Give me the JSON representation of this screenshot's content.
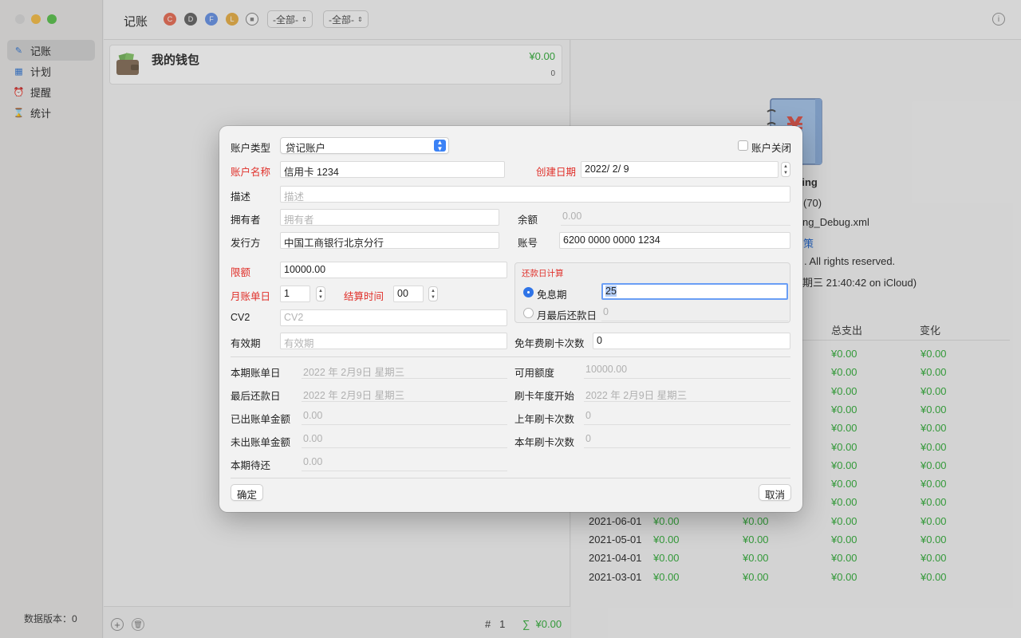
{
  "sidebar": {
    "items": [
      {
        "label": "记账",
        "icon": "edit-icon"
      },
      {
        "label": "计划",
        "icon": "calendar-icon"
      },
      {
        "label": "提醒",
        "icon": "alarm-icon"
      },
      {
        "label": "统计",
        "icon": "hourglass-icon"
      }
    ],
    "version": "数据版本：0"
  },
  "toolbar": {
    "title": "记账",
    "chips": [
      {
        "letter": "C",
        "color": "#e8735c"
      },
      {
        "letter": "D",
        "color": "#6b6b6b"
      },
      {
        "letter": "F",
        "color": "#6e97e6"
      },
      {
        "letter": "L",
        "color": "#e8b24f"
      }
    ],
    "filter1": "-全部-",
    "filter2": "-全部-"
  },
  "accounts": [
    {
      "name": "我的钱包",
      "balance": "¥0.00",
      "count": "0"
    }
  ],
  "list_footer": {
    "count_symbol": "#",
    "count": "1",
    "sum_symbol": "∑",
    "sum": "¥0.00"
  },
  "detail": {
    "app_name_fragment": "ting",
    "count_fragment": "(70)",
    "file_fragment": "ng_Debug.xml",
    "link_fragment": "策",
    "rights_fragment": ". All rights reserved.",
    "sync_fragment": "期三 21:40:42 on iCloud)",
    "headers": {
      "expense": "总支出",
      "change": "变化"
    },
    "rows": [
      {
        "date": "",
        "income": "",
        "expense": "¥0.00",
        "change": "¥0.00"
      },
      {
        "date": "",
        "income": "",
        "expense": "¥0.00",
        "change": "¥0.00"
      },
      {
        "date": "",
        "income": "",
        "expense": "¥0.00",
        "change": "¥0.00"
      },
      {
        "date": "",
        "income": "",
        "expense": "¥0.00",
        "change": "¥0.00"
      },
      {
        "date": "",
        "income": "",
        "expense": "¥0.00",
        "change": "¥0.00"
      },
      {
        "date": "",
        "income": "",
        "expense": "¥0.00",
        "change": "¥0.00"
      },
      {
        "date": "",
        "income": "",
        "expense": "¥0.00",
        "change": "¥0.00"
      },
      {
        "date": "",
        "income": "",
        "expense": "¥0.00",
        "change": "¥0.00"
      },
      {
        "date": "",
        "income": "",
        "expense": "¥0.00",
        "change": "¥0.00"
      },
      {
        "date": "2021-06-01",
        "income": "¥0.00",
        "expense": "¥0.00",
        "change": "¥0.00",
        "total": "¥0.00"
      },
      {
        "date": "2021-05-01",
        "income": "¥0.00",
        "expense": "¥0.00",
        "change": "¥0.00",
        "total": "¥0.00"
      },
      {
        "date": "2021-04-01",
        "income": "¥0.00",
        "expense": "¥0.00",
        "change": "¥0.00",
        "total": "¥0.00"
      },
      {
        "date": "2021-03-01",
        "income": "¥0.00",
        "expense": "¥0.00",
        "change": "¥0.00",
        "total": "¥0.00"
      }
    ]
  },
  "dialog": {
    "account_type_label": "账户类型",
    "account_type_value": "贷记账户",
    "closed_label": "账户关闭",
    "name_label": "账户名称",
    "name_value": "信用卡 1234",
    "created_label": "创建日期",
    "created_value": "2022/  2/  9",
    "desc_label": "描述",
    "desc_placeholder": "描述",
    "owner_label": "拥有者",
    "owner_placeholder": "拥有者",
    "balance_label": "余额",
    "balance_value": "0.00",
    "issuer_label": "发行方",
    "issuer_value": "中国工商银行北京分行",
    "acct_no_label": "账号",
    "acct_no_value": "6200 0000 0000 1234",
    "limit_label": "限额",
    "limit_value": "10000.00",
    "bill_day_label": "月账单日",
    "bill_day_value": "1",
    "settle_label": "结算时间",
    "settle_value": "00",
    "repay_group_title": "还款日计算",
    "grace_label": "免息期",
    "grace_value": "25",
    "last_repay_label": "月最后还款日",
    "last_repay_value": "0",
    "cv2_label": "CV2",
    "cv2_placeholder": "CV2",
    "expiry_label": "有效期",
    "expiry_placeholder": "有效期",
    "fee_free_label": "免年费刷卡次数",
    "fee_free_value": "0",
    "cur_bill_label": "本期账单日",
    "cur_bill_value": "2022 年 2月9日 星期三",
    "available_label": "可用额度",
    "available_value": "10000.00",
    "last_pay_label": "最后还款日",
    "last_pay_value": "2022 年 2月9日 星期三",
    "year_start_label": "刷卡年度开始",
    "year_start_value": "2022 年 2月9日 星期三",
    "billed_label": "已出账单金额",
    "billed_value": "0.00",
    "last_year_label": "上年刷卡次数",
    "last_year_value": "0",
    "unbilled_label": "未出账单金额",
    "unbilled_value": "0.00",
    "this_year_label": "本年刷卡次数",
    "this_year_value": "0",
    "due_label": "本期待还",
    "due_value": "0.00",
    "ok_label": "确定",
    "cancel_label": "取消"
  }
}
